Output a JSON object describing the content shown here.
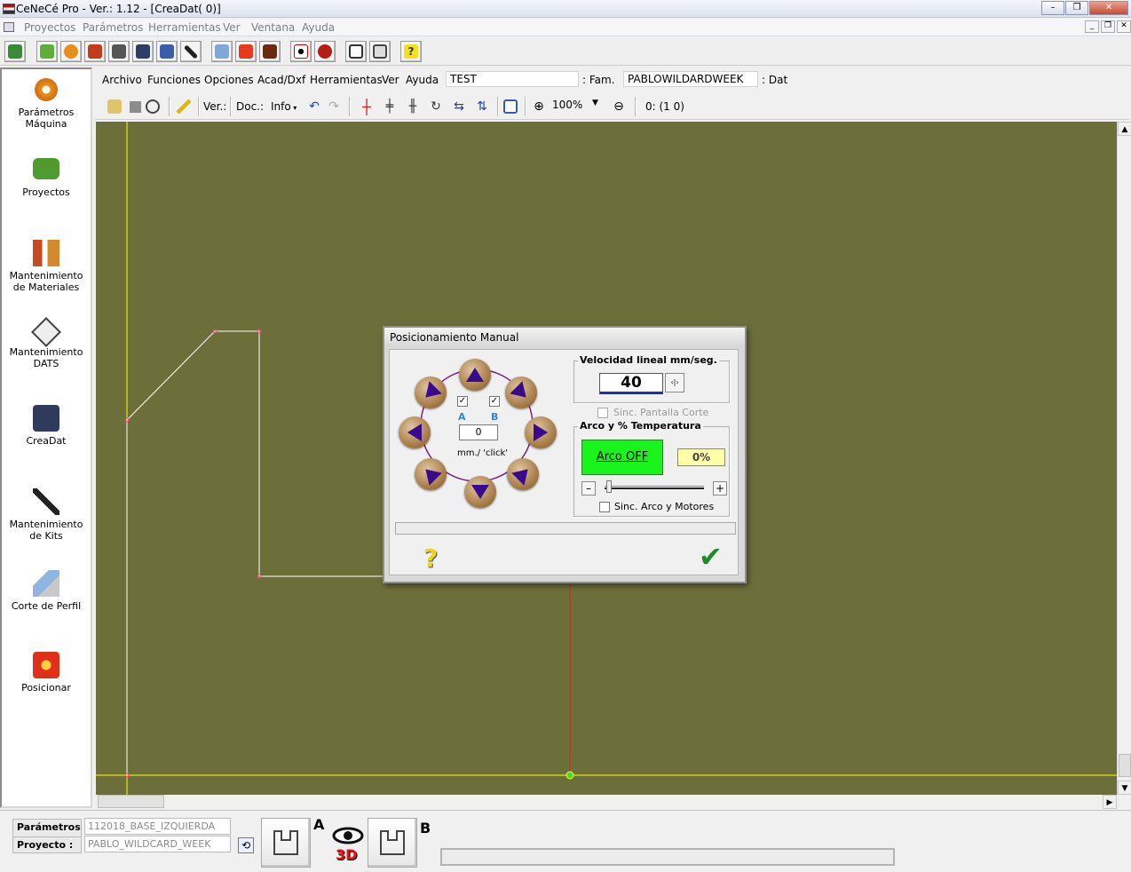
{
  "window": {
    "title": "CeNeCé Pro - Ver.: 1.12 - [CreaDat( 0)]"
  },
  "window_buttons": {
    "minimize": "–",
    "restore": "❐",
    "close": "✕"
  },
  "menubar": {
    "items": [
      "Proyectos",
      "Parámetros",
      "Herramientas",
      "Ver",
      "Ventana",
      "Ayuda"
    ]
  },
  "toolbar_icons": [
    "exit-icon",
    "folder-green-icon",
    "gear-icon",
    "materials-icon",
    "creadat-icon",
    "doc-icon",
    "kits-icon",
    "profile-cut-icon",
    "position-icon",
    "house-icon",
    "eye-3d-icon",
    "settings-red-icon",
    "panel-icon",
    "calculator-icon",
    "help-icon"
  ],
  "sidebar": {
    "items": [
      {
        "label": "Parámetros Máquina",
        "icon": "gear-icon"
      },
      {
        "label": "Proyectos",
        "icon": "folder-green-icon"
      },
      {
        "label": "Mantenimiento de Materiales",
        "icon": "materials-icon"
      },
      {
        "label": "Mantenimiento DATS",
        "icon": "dats-icon"
      },
      {
        "label": "CreaDat",
        "icon": "creadat-icon"
      },
      {
        "label": "Mantenimiento de Kits",
        "icon": "kits-icon"
      },
      {
        "label": "Corte de Perfil",
        "icon": "profile-cut-icon"
      },
      {
        "label": "Posicionar",
        "icon": "position-icon"
      }
    ]
  },
  "inner_menu": {
    "items": [
      "Archivo",
      "Funciones",
      "Opciones",
      "Acad/Dxf",
      "Herramientas",
      "Ver",
      "Ayuda"
    ],
    "name_value": "TEST",
    "fam_label": ": Fam.",
    "fam_value": "PABLOWILDARDWEEK",
    "dat_label": ": Dat"
  },
  "inner_toolbar": {
    "ver_label": "Ver.:",
    "doc_label": "Doc.:",
    "info_label": "Info",
    "zoom": "100%",
    "coords": "0: (1 0)"
  },
  "dialog": {
    "title": "Posicionamiento Manual",
    "axis_a": "A",
    "axis_b": "B",
    "step_value": "0",
    "step_unit": "mm./ 'click'",
    "speed_group": "Velocidad lineal mm/seg.",
    "speed_value": "40",
    "sync_screen": "Sinc. Pantalla Corte",
    "arc_group": "Arco y % Temperatura",
    "arc_button": "Arco OFF",
    "temp_percent": "0%",
    "minus": "–",
    "plus": "+",
    "sync_arc": "Sinc. Arco y Motores",
    "colors": {
      "arc_off": "#19f51c",
      "temp_bg": "#ffffa8",
      "arrow": "#3a0a8c"
    }
  },
  "status": {
    "param_label": "Parámetros :",
    "param_value": "112018_BASE_IZQUIERDA",
    "project_label": "Proyecto :",
    "project_value": "PABLO_WILDCARD_WEEK",
    "label_a": "A",
    "label_b": "B",
    "view_3d": "3D"
  },
  "canvas": {
    "background": "#6d6f3b",
    "line_color": "#ffffff",
    "axis_color": "#ffff00",
    "marker_color": "#ff0000"
  }
}
